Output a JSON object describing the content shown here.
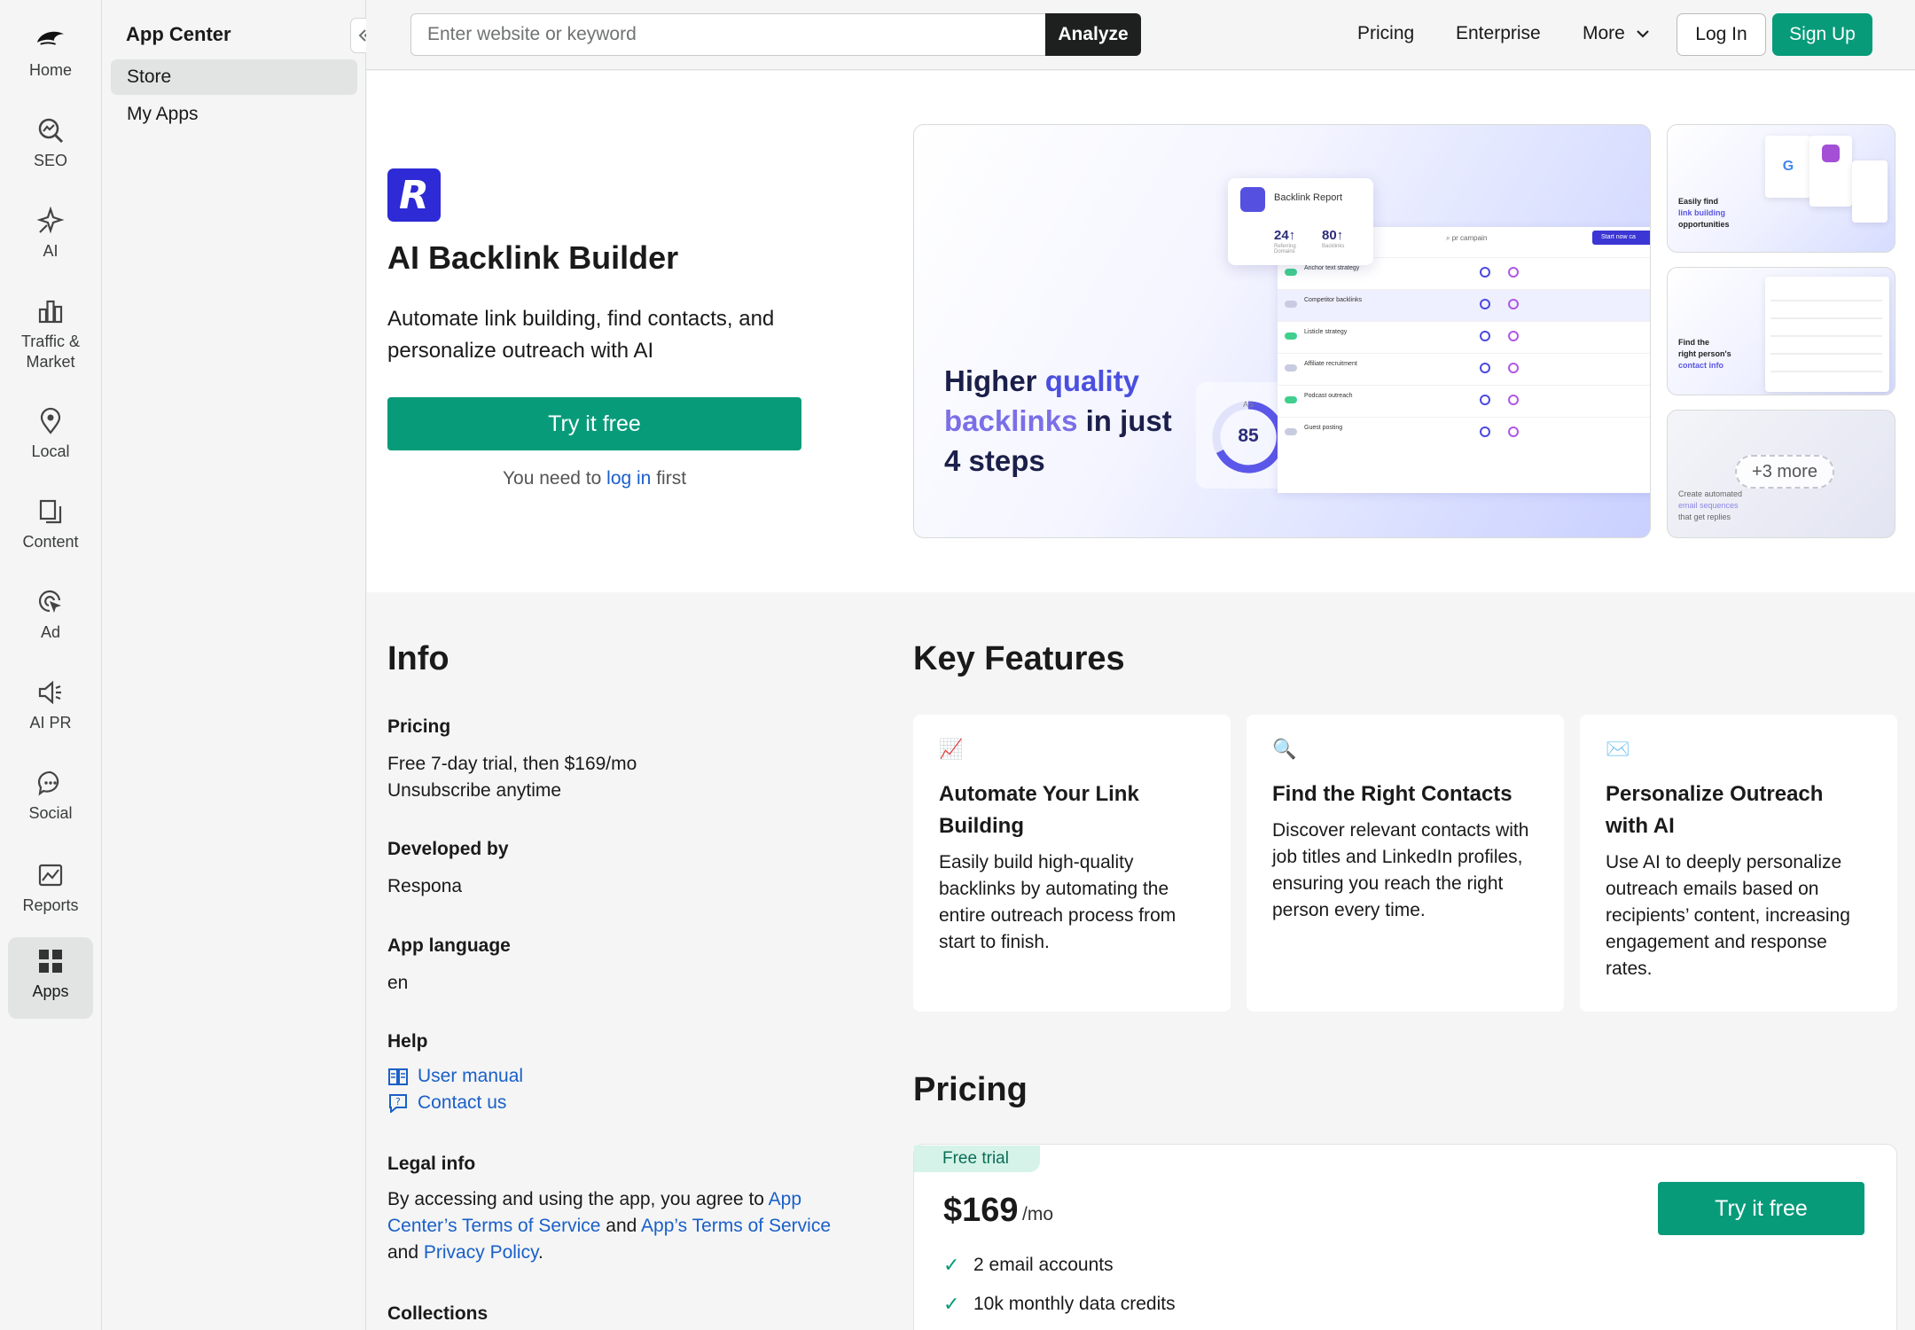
{
  "nav": {
    "items": [
      {
        "label": "Home",
        "icon": "home-icon"
      },
      {
        "label": "SEO",
        "icon": "seo-icon"
      },
      {
        "label": "AI",
        "icon": "ai-icon"
      },
      {
        "label": "Traffic &\nMarket",
        "icon": "traffic-market-icon"
      },
      {
        "label": "Local",
        "icon": "local-pin-icon"
      },
      {
        "label": "Content",
        "icon": "content-icon"
      },
      {
        "label": "Ad",
        "icon": "ad-icon"
      },
      {
        "label": "AI PR",
        "icon": "megaphone-icon"
      },
      {
        "label": "Social",
        "icon": "social-chat-icon"
      },
      {
        "label": "Reports",
        "icon": "reports-icon"
      },
      {
        "label": "Apps",
        "icon": "apps-grid-icon"
      }
    ]
  },
  "panel": {
    "title": "App Center",
    "items": [
      "Store",
      "My Apps"
    ]
  },
  "topbar": {
    "search_placeholder": "Enter website or keyword",
    "analyze": "Analyze",
    "links": [
      "Pricing",
      "Enterprise",
      "More"
    ],
    "login": "Log In",
    "signup": "Sign Up"
  },
  "hero": {
    "logo_letter": "R",
    "app_name": "AI Backlink Builder",
    "description": "Automate link building, find contacts, and personalize outreach with AI",
    "try_label": "Try it free",
    "need_prefix": "You need to",
    "need_link": "log in",
    "need_suffix": "first",
    "shot_main": {
      "headline_1": "Higher",
      "headline_2": "quality",
      "headline_3": "backlinks",
      "headline_4": "in just",
      "headline_5": "4 steps",
      "report_title": "Backlink Report",
      "stat1": "24↑",
      "stat2": "80↑",
      "stat1_label": "Referring Domains",
      "stat2_label": "Backlinks",
      "score_label": "AS",
      "score": "85",
      "search_text": "pr campain",
      "start_btn": "Start now ca",
      "rows": [
        "Anchor text strategy",
        "Competitor backlinks",
        "Listicle strategy",
        "Affiliate recruitment",
        "Podcast outreach",
        "Guest posting"
      ]
    },
    "shot_side_1": {
      "line1": "Easily find",
      "line2": "link building",
      "line3": "opportunities"
    },
    "shot_side_2": {
      "line1": "Find the",
      "line2": "right person's",
      "line3": "contact info"
    },
    "shot_side_3": {
      "more": "+3 more",
      "line1": "Create automated",
      "line2": "email sequences",
      "line3": "that get replies"
    }
  },
  "info": {
    "title": "Info",
    "pricing_label": "Pricing",
    "pricing_val_1": "Free 7-day trial, then $169/mo",
    "pricing_val_2": "Unsubscribe anytime",
    "dev_label": "Developed by",
    "dev_val": "Respona",
    "lang_label": "App language",
    "lang_val": "en",
    "help_label": "Help",
    "help_manual": "User manual",
    "help_contact": "Contact us",
    "legal_label": "Legal info",
    "legal_1": "By accessing and using the app, you agree to",
    "legal_link_1": "App Center’s Terms of Service",
    "legal_and_1": "and",
    "legal_link_2": "App’s Terms of Service",
    "legal_and_2": "and",
    "legal_link_3": "Privacy Policy",
    "legal_end": ".",
    "collections_label": "Collections"
  },
  "features": {
    "title": "Key Features",
    "items": [
      {
        "icon": "📈",
        "title": "Automate Your Link Building",
        "desc": "Easily build high-quality backlinks by automating the entire outreach process from start to finish."
      },
      {
        "icon": "🔍",
        "title": "Find the Right Contacts",
        "desc": "Discover relevant contacts with job titles and LinkedIn profiles, ensuring you reach the right person every time."
      },
      {
        "icon": "✉️",
        "title": "Personalize Outreach with AI",
        "desc": "Use AI to deeply personalize outreach emails based on recipients’ content, increasing engagement and response rates."
      }
    ]
  },
  "pricing": {
    "title": "Pricing",
    "badge": "Free trial",
    "price": "$169",
    "per": "/mo",
    "try_label": "Try it free",
    "perks": [
      "2 email accounts",
      "10k monthly data credits"
    ]
  }
}
